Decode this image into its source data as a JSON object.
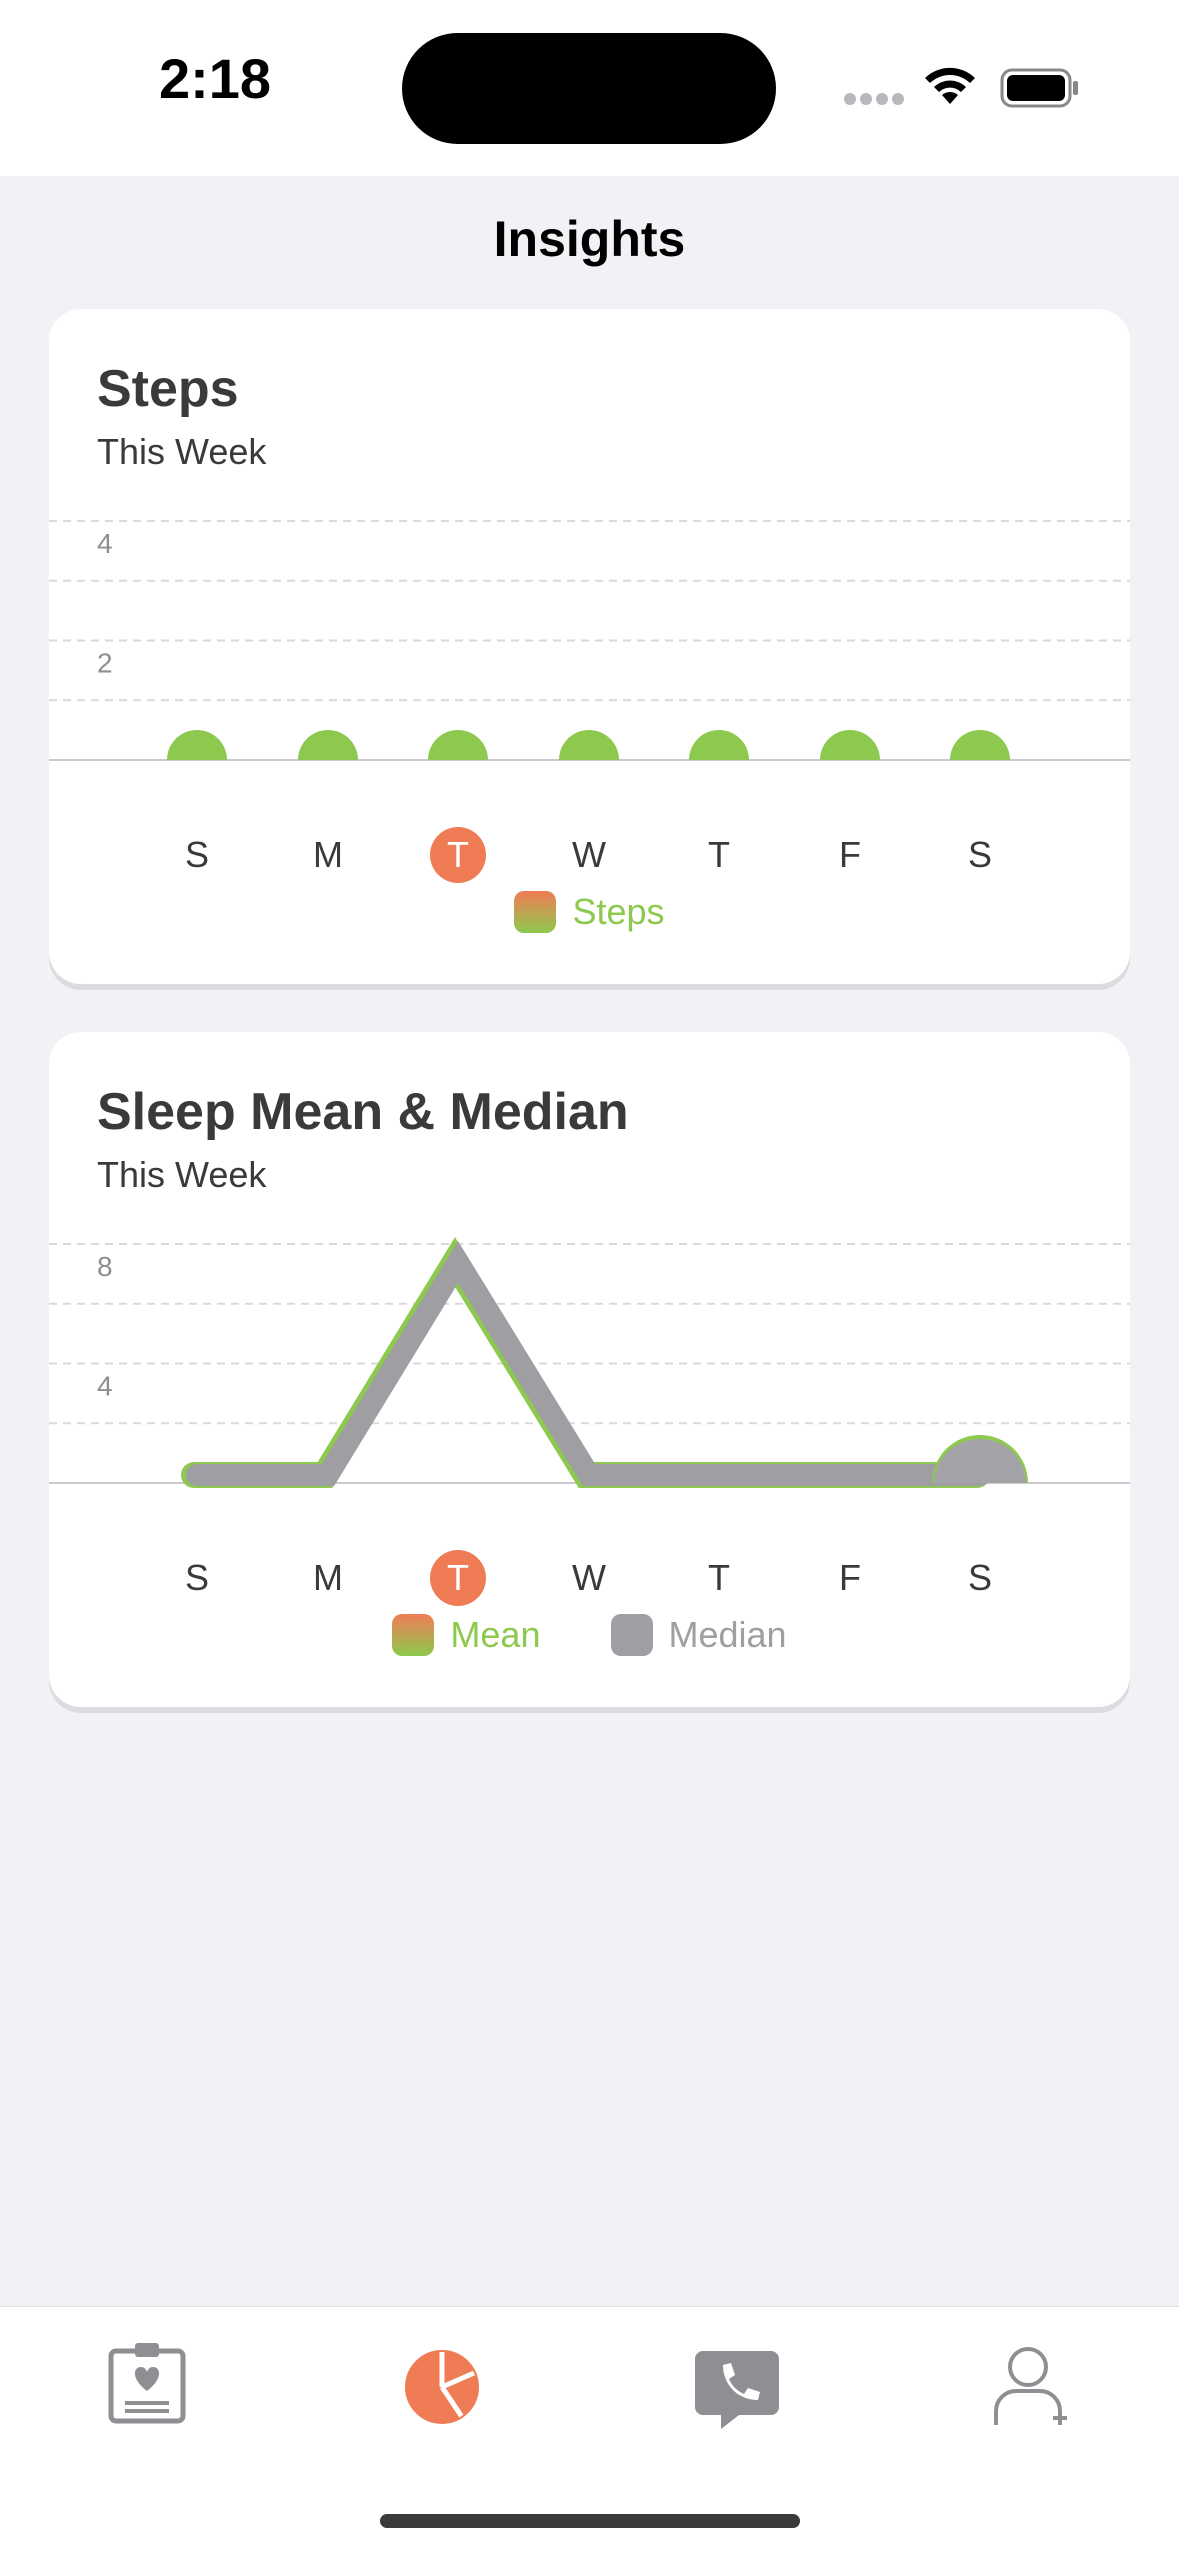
{
  "status": {
    "time": "2:18"
  },
  "nav": {
    "title": "Insights"
  },
  "steps_card": {
    "title": "Steps",
    "subtitle": "This Week",
    "legend": [
      "Steps"
    ]
  },
  "sleep_card": {
    "title": "Sleep Mean & Median",
    "subtitle": "This Week",
    "legend": [
      "Mean",
      "Median"
    ]
  },
  "chart_data": [
    {
      "type": "bar",
      "categories": [
        "S",
        "M",
        "T",
        "W",
        "T",
        "F",
        "S"
      ],
      "values": [
        0,
        0,
        0,
        0,
        0,
        0,
        0
      ],
      "ylim": [
        0,
        4
      ],
      "yticks": [
        2,
        4
      ],
      "highlight_index": 2,
      "grid": true,
      "legend_position": "bottom",
      "series": [
        {
          "name": "Steps",
          "values": [
            0,
            0,
            0,
            0,
            0,
            0,
            0
          ]
        }
      ],
      "colors": {
        "bar": "#8DC94E",
        "highlight": "#F07C55"
      }
    },
    {
      "type": "line",
      "categories": [
        "S",
        "M",
        "T",
        "W",
        "T",
        "F",
        "S"
      ],
      "ylim": [
        0,
        8
      ],
      "yticks": [
        4,
        8
      ],
      "highlight_index": 2,
      "grid": true,
      "legend_position": "bottom",
      "series": [
        {
          "name": "Mean",
          "values": [
            0,
            0,
            8,
            0,
            0,
            0,
            0
          ],
          "color": "#8DC94E"
        },
        {
          "name": "Median",
          "values": [
            0,
            0,
            8,
            0,
            0,
            0,
            0
          ],
          "color": "#9E9EA3"
        }
      ]
    }
  ],
  "tabs": [
    {
      "icon": "clipboard-heart-icon"
    },
    {
      "icon": "pie-chart-icon",
      "active": true
    },
    {
      "icon": "phone-bubble-icon"
    },
    {
      "icon": "person-plus-icon"
    }
  ],
  "colors": {
    "accent": "#F07C55",
    "green": "#8DC94E",
    "gray": "#9E9EA3",
    "background": "#F1F1F6"
  }
}
